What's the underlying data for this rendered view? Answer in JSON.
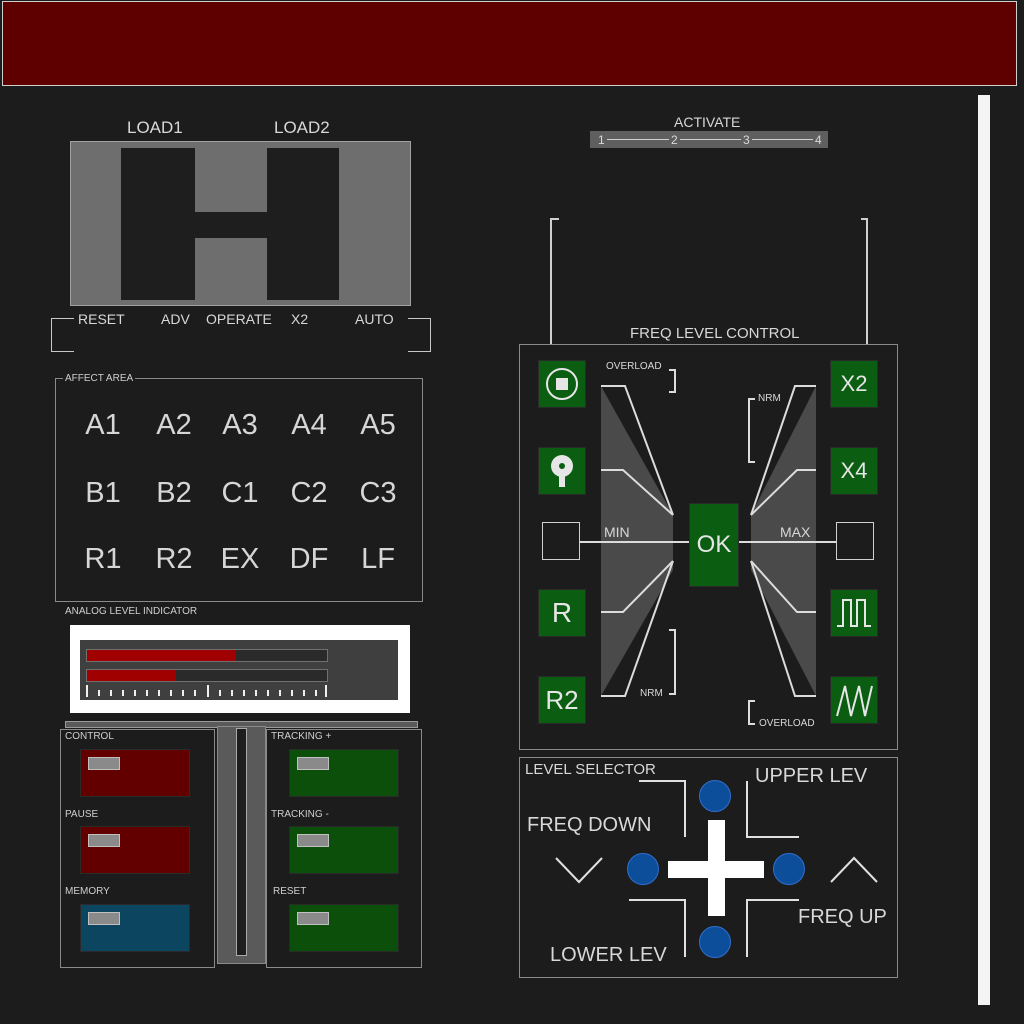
{
  "load": {
    "load1_label": "LOAD1",
    "load2_label": "LOAD2"
  },
  "modes": [
    "RESET",
    "ADV",
    "OPERATE",
    "X2",
    "AUTO"
  ],
  "activate": {
    "label": "ACTIVATE",
    "steps": [
      "1",
      "2",
      "3",
      "4"
    ]
  },
  "affect_area": {
    "title": "AFFECT AREA",
    "rows": [
      [
        "A1",
        "A2",
        "A3",
        "A4",
        "A5"
      ],
      [
        "B1",
        "B2",
        "C1",
        "C2",
        "C3"
      ],
      [
        "R1",
        "R2",
        "EX",
        "DF",
        "LF"
      ]
    ]
  },
  "analog": {
    "title": "ANALOG LEVEL INDICATOR",
    "bar1_level": 0.62,
    "bar2_level": 0.37
  },
  "left_controls": [
    {
      "label": "CONTROL",
      "color": "#620000"
    },
    {
      "label": "PAUSE",
      "color": "#620000"
    },
    {
      "label": "MEMORY",
      "color": "#0c4560"
    }
  ],
  "right_controls": [
    {
      "label": "TRACKING +",
      "color": "#0b4f0b"
    },
    {
      "label": "TRACKING -",
      "color": "#0b4f0b"
    },
    {
      "label": "RESET",
      "color": "#0b4f0b"
    }
  ],
  "freq": {
    "title": "FREQ LEVEL CONTROL",
    "ok": "OK",
    "min": "MIN",
    "max": "MAX",
    "overload": "OVERLOAD",
    "nrm": "NRM",
    "left_buttons": [
      "stop-icon",
      "knob-icon",
      "R",
      "R2"
    ],
    "right_buttons": [
      "X2",
      "X4",
      "square-wave-icon",
      "sawtooth-wave-icon"
    ]
  },
  "level_selector": {
    "title": "LEVEL SELECTOR",
    "upper": "UPPER LEV",
    "lower": "LOWER LEV",
    "freq_down": "FREQ DOWN",
    "freq_up": "FREQ UP"
  },
  "colors": {
    "banner": "#5e0000",
    "green": "#0b5d12",
    "blue": "#0c4e9a"
  }
}
